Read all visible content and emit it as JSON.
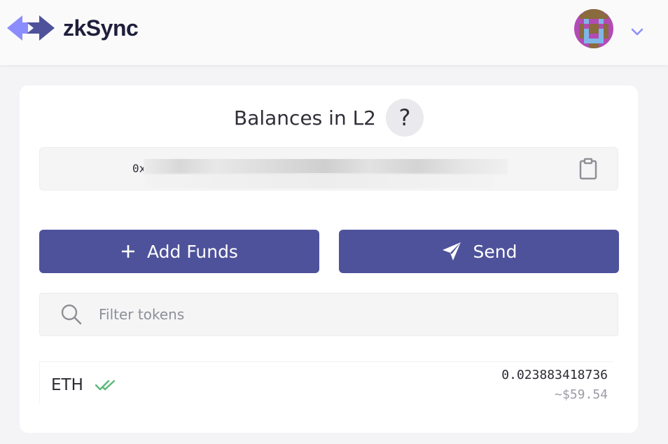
{
  "header": {
    "app_name": "zkSync",
    "logo_icon": "zksync-arrows-logo",
    "avatar_icon": "identicon-avatar",
    "menu_icon": "chevron-down-icon",
    "colors": {
      "logo_light": "#8c8dfc",
      "logo_dark": "#4e529a",
      "chevron": "#8c8dfc"
    }
  },
  "balances": {
    "title": "Balances in L2",
    "help_label": "?",
    "address_prefix": "0x",
    "copy_icon": "clipboard-icon"
  },
  "actions": {
    "add_funds_label": "Add Funds",
    "add_funds_icon": "plus-icon",
    "send_label": "Send",
    "send_icon": "paper-plane-icon",
    "button_color": "#4e529a"
  },
  "search": {
    "placeholder": "Filter tokens",
    "value": "",
    "icon": "search-icon"
  },
  "tokens": [
    {
      "symbol": "ETH",
      "status_icon": "double-check-icon",
      "balance": "0.023883418736",
      "usd_value": "~$59.54",
      "status_color": "#5cb87a"
    }
  ]
}
